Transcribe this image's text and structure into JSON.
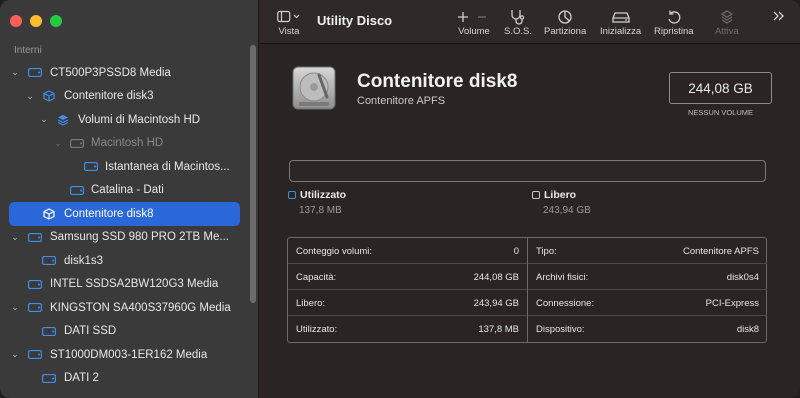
{
  "app": {
    "title": "Utility Disco"
  },
  "toolbar": {
    "view_label": "Vista",
    "volume_label": "Volume",
    "sos_label": "S.O.S.",
    "partition_label": "Partiziona",
    "erase_label": "Inizializza",
    "restore_label": "Ripristina",
    "mount_label": "Attiva"
  },
  "sidebar": {
    "section": "Interni",
    "items": [
      {
        "label": "CT500P3PSSD8 Media",
        "icon": "drive-icon"
      },
      {
        "label": "Contenitore disk3",
        "icon": "container-icon"
      },
      {
        "label": "Volumi di Macintosh HD",
        "icon": "volume-group-icon"
      },
      {
        "label": "Macintosh HD",
        "icon": "volume-icon"
      },
      {
        "label": "Istantanea di Macintos...",
        "icon": "snapshot-icon"
      },
      {
        "label": "Catalina - Dati",
        "icon": "volume-icon"
      },
      {
        "label": "Contenitore disk8",
        "icon": "container-icon"
      },
      {
        "label": "Samsung SSD 980 PRO 2TB Me...",
        "icon": "drive-icon"
      },
      {
        "label": "disk1s3",
        "icon": "volume-icon"
      },
      {
        "label": "INTEL SSDSA2BW120G3 Media",
        "icon": "drive-icon"
      },
      {
        "label": "KINGSTON SA400S37960G Media",
        "icon": "drive-icon"
      },
      {
        "label": "DATI SSD",
        "icon": "volume-icon"
      },
      {
        "label": "ST1000DM003-1ER162 Media",
        "icon": "drive-icon"
      },
      {
        "label": "DATI 2",
        "icon": "volume-icon"
      }
    ]
  },
  "disk": {
    "name": "Contenitore disk8",
    "subtitle": "Contenitore APFS",
    "size": "244,08 GB",
    "size_caption": "NESSUN VOLUME"
  },
  "usage": {
    "used_label": "Utilizzato",
    "used_value": "137,8 MB",
    "used_color": "#3b8ee8",
    "free_label": "Libero",
    "free_value": "243,94 GB"
  },
  "info": {
    "left": [
      {
        "key": "Conteggio volumi:",
        "value": "0"
      },
      {
        "key": "Capacità:",
        "value": "244,08 GB"
      },
      {
        "key": "Libero:",
        "value": "243,94 GB"
      },
      {
        "key": "Utilizzato:",
        "value": "137,8 MB"
      }
    ],
    "right": [
      {
        "key": "Tipo:",
        "value": "Contenitore APFS"
      },
      {
        "key": "Archivi fisici:",
        "value": "disk0s4"
      },
      {
        "key": "Connessione:",
        "value": "PCI-Express"
      },
      {
        "key": "Dispositivo:",
        "value": "disk8"
      }
    ]
  }
}
